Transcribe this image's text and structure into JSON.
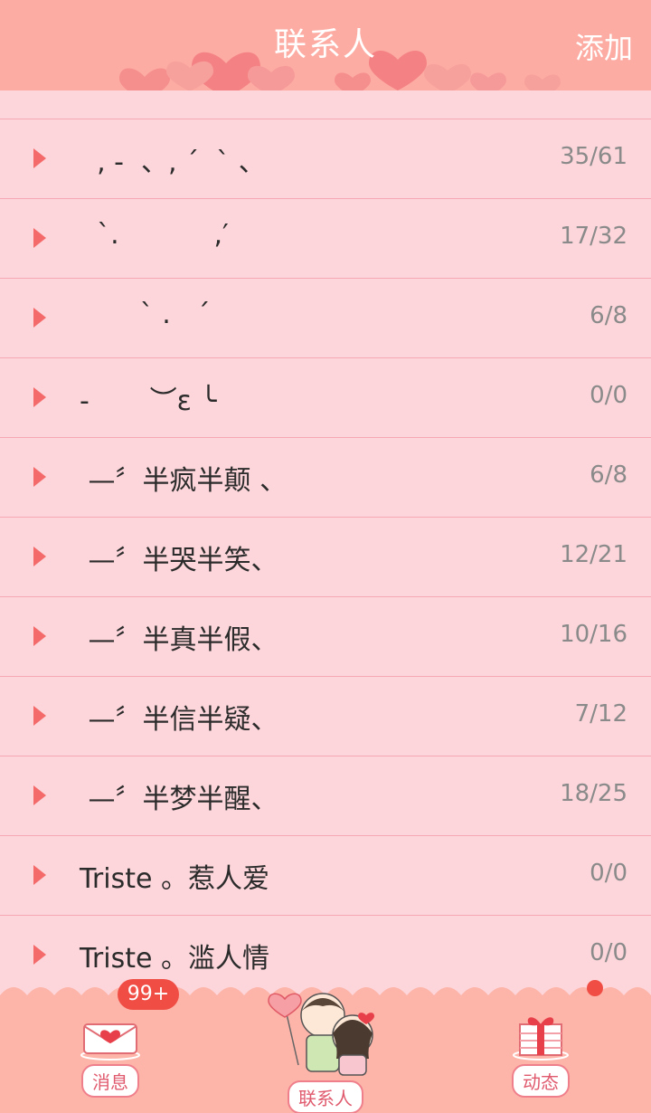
{
  "header": {
    "title": "联系人",
    "add_label": "添加"
  },
  "groups": [
    {
      "name": "  , -  、, ´  ` 、",
      "count": "35/61"
    },
    {
      "name": "  `.           ,′",
      "count": "17/32"
    },
    {
      "name": "       ` .   ´",
      "count": "6/8"
    },
    {
      "name": "-       ︶ε ╰",
      "count": "0/0"
    },
    {
      "name": " —〞半疯半颠 、",
      "count": "6/8"
    },
    {
      "name": " —〞半哭半笑、",
      "count": "12/21"
    },
    {
      "name": " —〞半真半假、",
      "count": "10/16"
    },
    {
      "name": " —〞半信半疑、",
      "count": "7/12"
    },
    {
      "name": " —〞半梦半醒、",
      "count": "18/25"
    },
    {
      "name": "Triste 。惹人爱",
      "count": "0/0"
    },
    {
      "name": "Triste 。滥人情",
      "count": "0/0"
    }
  ],
  "bottom_nav": {
    "messages_label": "消息",
    "messages_badge": "99+",
    "contacts_label": "联系人",
    "feed_label": "动态"
  },
  "colors": {
    "header_bg": "#fdaca3",
    "list_bg": "#fcd6da",
    "divider": "#f5a7b5",
    "arrow": "#f46a6a",
    "badge": "#f04e45"
  }
}
